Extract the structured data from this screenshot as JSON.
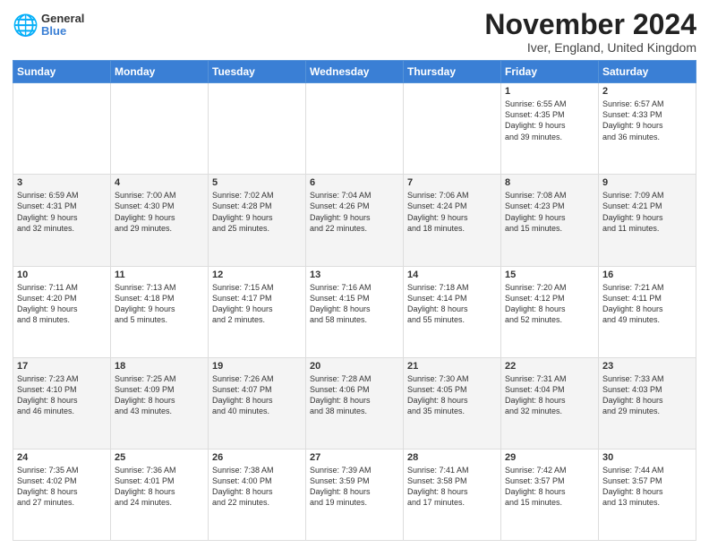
{
  "header": {
    "logo_general": "General",
    "logo_blue": "Blue",
    "month": "November 2024",
    "location": "Iver, England, United Kingdom"
  },
  "days_of_week": [
    "Sunday",
    "Monday",
    "Tuesday",
    "Wednesday",
    "Thursday",
    "Friday",
    "Saturday"
  ],
  "weeks": [
    [
      {
        "day": "",
        "info": ""
      },
      {
        "day": "",
        "info": ""
      },
      {
        "day": "",
        "info": ""
      },
      {
        "day": "",
        "info": ""
      },
      {
        "day": "",
        "info": ""
      },
      {
        "day": "1",
        "info": "Sunrise: 6:55 AM\nSunset: 4:35 PM\nDaylight: 9 hours\nand 39 minutes."
      },
      {
        "day": "2",
        "info": "Sunrise: 6:57 AM\nSunset: 4:33 PM\nDaylight: 9 hours\nand 36 minutes."
      }
    ],
    [
      {
        "day": "3",
        "info": "Sunrise: 6:59 AM\nSunset: 4:31 PM\nDaylight: 9 hours\nand 32 minutes."
      },
      {
        "day": "4",
        "info": "Sunrise: 7:00 AM\nSunset: 4:30 PM\nDaylight: 9 hours\nand 29 minutes."
      },
      {
        "day": "5",
        "info": "Sunrise: 7:02 AM\nSunset: 4:28 PM\nDaylight: 9 hours\nand 25 minutes."
      },
      {
        "day": "6",
        "info": "Sunrise: 7:04 AM\nSunset: 4:26 PM\nDaylight: 9 hours\nand 22 minutes."
      },
      {
        "day": "7",
        "info": "Sunrise: 7:06 AM\nSunset: 4:24 PM\nDaylight: 9 hours\nand 18 minutes."
      },
      {
        "day": "8",
        "info": "Sunrise: 7:08 AM\nSunset: 4:23 PM\nDaylight: 9 hours\nand 15 minutes."
      },
      {
        "day": "9",
        "info": "Sunrise: 7:09 AM\nSunset: 4:21 PM\nDaylight: 9 hours\nand 11 minutes."
      }
    ],
    [
      {
        "day": "10",
        "info": "Sunrise: 7:11 AM\nSunset: 4:20 PM\nDaylight: 9 hours\nand 8 minutes."
      },
      {
        "day": "11",
        "info": "Sunrise: 7:13 AM\nSunset: 4:18 PM\nDaylight: 9 hours\nand 5 minutes."
      },
      {
        "day": "12",
        "info": "Sunrise: 7:15 AM\nSunset: 4:17 PM\nDaylight: 9 hours\nand 2 minutes."
      },
      {
        "day": "13",
        "info": "Sunrise: 7:16 AM\nSunset: 4:15 PM\nDaylight: 8 hours\nand 58 minutes."
      },
      {
        "day": "14",
        "info": "Sunrise: 7:18 AM\nSunset: 4:14 PM\nDaylight: 8 hours\nand 55 minutes."
      },
      {
        "day": "15",
        "info": "Sunrise: 7:20 AM\nSunset: 4:12 PM\nDaylight: 8 hours\nand 52 minutes."
      },
      {
        "day": "16",
        "info": "Sunrise: 7:21 AM\nSunset: 4:11 PM\nDaylight: 8 hours\nand 49 minutes."
      }
    ],
    [
      {
        "day": "17",
        "info": "Sunrise: 7:23 AM\nSunset: 4:10 PM\nDaylight: 8 hours\nand 46 minutes."
      },
      {
        "day": "18",
        "info": "Sunrise: 7:25 AM\nSunset: 4:09 PM\nDaylight: 8 hours\nand 43 minutes."
      },
      {
        "day": "19",
        "info": "Sunrise: 7:26 AM\nSunset: 4:07 PM\nDaylight: 8 hours\nand 40 minutes."
      },
      {
        "day": "20",
        "info": "Sunrise: 7:28 AM\nSunset: 4:06 PM\nDaylight: 8 hours\nand 38 minutes."
      },
      {
        "day": "21",
        "info": "Sunrise: 7:30 AM\nSunset: 4:05 PM\nDaylight: 8 hours\nand 35 minutes."
      },
      {
        "day": "22",
        "info": "Sunrise: 7:31 AM\nSunset: 4:04 PM\nDaylight: 8 hours\nand 32 minutes."
      },
      {
        "day": "23",
        "info": "Sunrise: 7:33 AM\nSunset: 4:03 PM\nDaylight: 8 hours\nand 29 minutes."
      }
    ],
    [
      {
        "day": "24",
        "info": "Sunrise: 7:35 AM\nSunset: 4:02 PM\nDaylight: 8 hours\nand 27 minutes."
      },
      {
        "day": "25",
        "info": "Sunrise: 7:36 AM\nSunset: 4:01 PM\nDaylight: 8 hours\nand 24 minutes."
      },
      {
        "day": "26",
        "info": "Sunrise: 7:38 AM\nSunset: 4:00 PM\nDaylight: 8 hours\nand 22 minutes."
      },
      {
        "day": "27",
        "info": "Sunrise: 7:39 AM\nSunset: 3:59 PM\nDaylight: 8 hours\nand 19 minutes."
      },
      {
        "day": "28",
        "info": "Sunrise: 7:41 AM\nSunset: 3:58 PM\nDaylight: 8 hours\nand 17 minutes."
      },
      {
        "day": "29",
        "info": "Sunrise: 7:42 AM\nSunset: 3:57 PM\nDaylight: 8 hours\nand 15 minutes."
      },
      {
        "day": "30",
        "info": "Sunrise: 7:44 AM\nSunset: 3:57 PM\nDaylight: 8 hours\nand 13 minutes."
      }
    ]
  ]
}
